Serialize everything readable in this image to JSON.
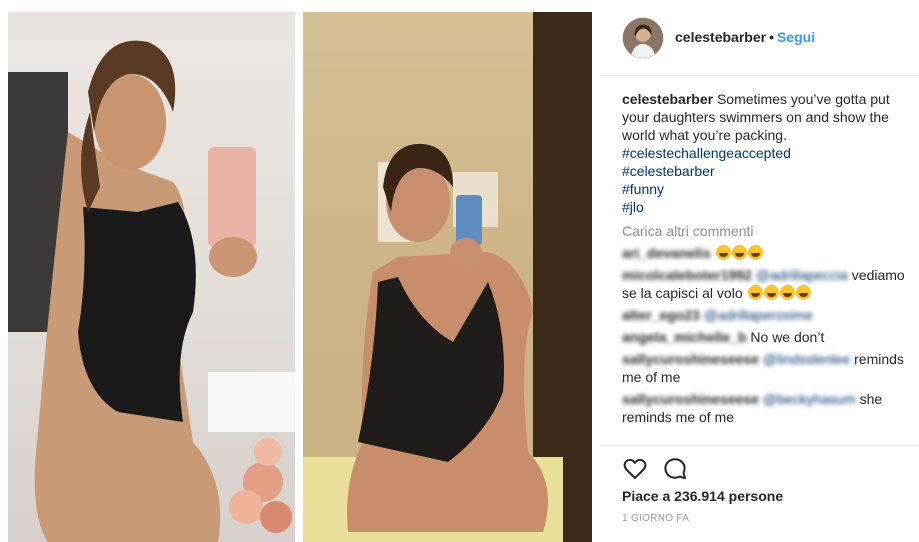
{
  "post": {
    "username": "celestebarber",
    "separator": "•",
    "follow_label": "Segui"
  },
  "caption": {
    "username": "celestebarber",
    "text": "Sometimes you’ve gotta put your daughters swimmers on and show the world what you’re packing.",
    "hashtags": [
      "#celestechallengeaccepted",
      "#celestebarber",
      "#funny",
      "#jlo"
    ]
  },
  "load_more_label": "Carica altri commenti",
  "comments": [
    {
      "user": "ari_devanelis",
      "mention": "",
      "text": ""
    },
    {
      "user": "micolcaleboter1992",
      "mention": "@adrillapeccia",
      "text": "vediamo se la capisci al volo"
    },
    {
      "user": "alter_ego23",
      "mention": "@adrillaperoxime",
      "text": ""
    },
    {
      "user": "angela_michelle_b",
      "mention": "",
      "text": "No we don’t"
    },
    {
      "user": "sallycuroshineseese",
      "mention": "@lindsslenlee",
      "text": "reminds me of me"
    },
    {
      "user": "sallycuroshineseese",
      "mention": "@beckyhasum",
      "text": "she reminds me of me"
    }
  ],
  "actions": {
    "likes_text": "Piace a 236.914 persone",
    "timestamp": "1 GIORNO FA"
  },
  "colors": {
    "link": "#3897f0",
    "hashtag": "#003569",
    "muted": "#8e8e8e",
    "text": "#262626"
  },
  "icons": {
    "like": "heart-outline-icon",
    "comment": "speech-bubble-icon"
  }
}
